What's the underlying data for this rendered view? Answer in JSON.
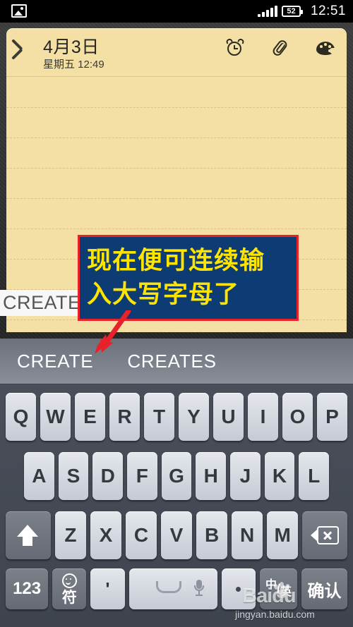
{
  "statusbar": {
    "image_icon": "image-icon",
    "signal_icon": "signal-bars-icon",
    "battery_level": "52",
    "time": "12:51"
  },
  "note": {
    "back_icon": "back-chevron-icon",
    "title": "4月3日",
    "subtitle": "星期五 12:49",
    "icons": [
      {
        "name": "alarm-icon"
      },
      {
        "name": "attachment-icon"
      },
      {
        "name": "palette-icon"
      }
    ],
    "composing_text": "CREATE"
  },
  "annotation": {
    "line1": "现在便可连续输",
    "line2": "入大写字母了",
    "box_color": "#0d3b73",
    "border_color": "#e8212b",
    "text_color": "#ffe400",
    "arrow_color": "#e8212b"
  },
  "keyboard": {
    "suggestions": [
      "CREATE",
      "CREATES"
    ],
    "row1": [
      "Q",
      "W",
      "E",
      "R",
      "T",
      "Y",
      "U",
      "I",
      "O",
      "P"
    ],
    "row2": [
      "A",
      "S",
      "D",
      "F",
      "G",
      "H",
      "J",
      "K",
      "L"
    ],
    "row3": {
      "shift": "shift-caps-icon",
      "letters": [
        "Z",
        "X",
        "C",
        "V",
        "B",
        "N",
        "M"
      ],
      "delete": "backspace-icon"
    },
    "row4": {
      "numeric": "123",
      "symbol": "符",
      "apostrophe": "'",
      "space": "space-key",
      "period": "·",
      "lang_cn": "中",
      "lang_sep": "/",
      "lang_en": "英",
      "confirm": "确认"
    }
  },
  "watermark": {
    "brand": "Baidu",
    "url": "jingyan.baidu.com"
  }
}
